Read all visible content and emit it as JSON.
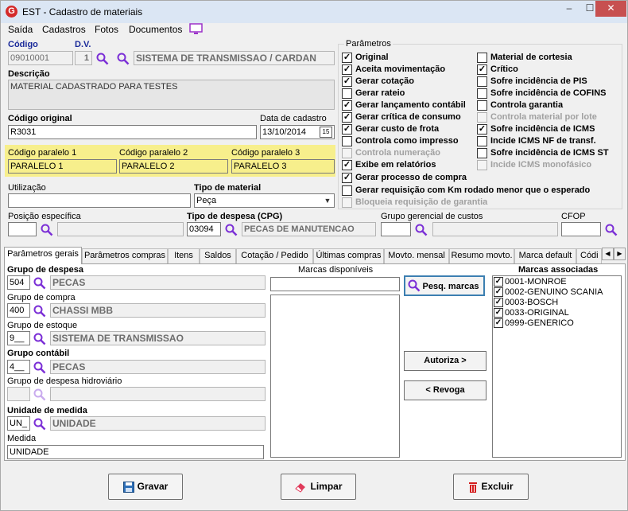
{
  "window": {
    "title": "EST - Cadastro de materiais",
    "minimize": "–",
    "maximize": "☐",
    "close": "✕"
  },
  "menu": [
    {
      "label": "Saída"
    },
    {
      "label": "Cadastros"
    },
    {
      "label": "Fotos"
    },
    {
      "label": "Documentos"
    }
  ],
  "form": {
    "codigo_label": "Código",
    "codigo_value": "09010001",
    "dv_label": "D.V.",
    "dv_value": "1",
    "grupo_value": "SISTEMA DE TRANSMISSAO / CARDAN",
    "descricao_label": "Descrição",
    "descricao_value": "MATERIAL CADASTRADO PARA TESTES",
    "codigo_original_label": "Código original",
    "codigo_original_value": "R3031",
    "data_cadastro_label": "Data de cadastro",
    "data_cadastro_value": "13/10/2014",
    "calendar_label": "15",
    "paralelo1_label": "Código paralelo 1",
    "paralelo1_value": "PARALELO 1",
    "paralelo2_label": "Código paralelo 2",
    "paralelo2_value": "PARALELO 2",
    "paralelo3_label": "Código paralelo 3",
    "paralelo3_value": "PARALELO 3",
    "utilizacao_label": "Utilização",
    "utilizacao_value": "",
    "tipo_material_label": "Tipo de material",
    "tipo_material_value": "Peça",
    "posicao_label": "Posição específica",
    "posicao_value": "",
    "tipo_despesa_label": "Tipo de despesa (CPG)",
    "tipo_despesa_code": "03094",
    "tipo_despesa_desc": "PECAS DE MANUTENCAO",
    "grupo_gerencial_label": "Grupo gerencial de custos",
    "grupo_gerencial_value": "",
    "cfop_label": "CFOP",
    "cfop_value": ""
  },
  "parametros": {
    "title": "Parâmetros",
    "left": [
      {
        "label": "Original",
        "checked": "✓",
        "disabled": false
      },
      {
        "label": "Aceita movimentação",
        "checked": "✓",
        "disabled": false
      },
      {
        "label": "Gerar cotação",
        "checked": "✓",
        "disabled": false
      },
      {
        "label": "Gerar rateio",
        "checked": "",
        "disabled": false
      },
      {
        "label": "Gerar lançamento contábil",
        "checked": "✓",
        "disabled": false
      },
      {
        "label": "Gerar crítica de consumo",
        "checked": "✓",
        "disabled": false
      },
      {
        "label": "Gerar custo de frota",
        "checked": "✓",
        "disabled": false
      },
      {
        "label": "Controla como impresso",
        "checked": "",
        "disabled": false
      },
      {
        "label": "Controla numeração",
        "checked": "",
        "disabled": true
      },
      {
        "label": "Exibe em relatórios",
        "checked": "✓",
        "disabled": false
      }
    ],
    "right": [
      {
        "label": "Material de cortesia",
        "checked": "",
        "disabled": false
      },
      {
        "label": "Crítico",
        "checked": "✓",
        "disabled": false
      },
      {
        "label": "Sofre incidência de PIS",
        "checked": "",
        "disabled": false
      },
      {
        "label": "Sofre incidência de COFINS",
        "checked": "",
        "disabled": false
      },
      {
        "label": "Controla garantia",
        "checked": "",
        "disabled": false
      },
      {
        "label": "Controla material por lote",
        "checked": "",
        "disabled": true
      },
      {
        "label": "Sofre incidência de ICMS",
        "checked": "✓",
        "disabled": false
      },
      {
        "label": "Incide ICMS NF de transf.",
        "checked": "",
        "disabled": false
      },
      {
        "label": "Sofre incidência de ICMS ST",
        "checked": "",
        "disabled": false
      },
      {
        "label": "Incide ICMS monofásico",
        "checked": "",
        "disabled": true
      }
    ],
    "bottom": [
      {
        "label": "Gerar processo de compra",
        "checked": "✓",
        "disabled": false
      },
      {
        "label": "Gerar requisição com Km rodado menor que o esperado",
        "checked": "",
        "disabled": false
      },
      {
        "label": "Bloqueia requisição de garantia",
        "checked": "",
        "disabled": true
      }
    ]
  },
  "tabs": [
    {
      "label": "Parâmetros gerais"
    },
    {
      "label": "Parâmetros compras"
    },
    {
      "label": "Itens"
    },
    {
      "label": "Saldos"
    },
    {
      "label": "Cotação / Pedido"
    },
    {
      "label": "Últimas compras"
    },
    {
      "label": "Movto. mensal"
    },
    {
      "label": "Resumo movto."
    },
    {
      "label": "Marca default"
    },
    {
      "label": "Códi"
    }
  ],
  "tab_scroll": {
    "left": "◀",
    "right": "▶"
  },
  "panel": {
    "grupo_despesa_label": "Grupo de despesa",
    "grupo_despesa_code": "504",
    "grupo_despesa_desc": "PECAS",
    "grupo_compra_label": "Grupo de compra",
    "grupo_compra_code": "400",
    "grupo_compra_desc": "CHASSI MBB",
    "grupo_estoque_label": "Grupo de estoque",
    "grupo_estoque_code": "9__",
    "grupo_estoque_desc": "SISTEMA DE TRANSMISSAO",
    "grupo_contabil_label": "Grupo contábil",
    "grupo_contabil_code": "4__",
    "grupo_contabil_desc": "PECAS",
    "grupo_hidro_label": "Grupo de despesa hidroviário",
    "grupo_hidro_code": "",
    "grupo_hidro_desc": "",
    "unidade_label": "Unidade de medida",
    "unidade_code": "UN_",
    "unidade_desc": "UNIDADE",
    "medida_label": "Medida",
    "medida_value": "UNIDADE",
    "marcas_disponiveis_label": "Marcas disponíveis",
    "marcas_search_value": "",
    "pesq_marcas": "Pesq. marcas",
    "autoriza": "Autoriza >",
    "revoga": "< Revoga",
    "marcas_associadas_label": "Marcas associadas",
    "marcas_associadas": [
      {
        "label": "0001-MONROE",
        "checked": "✓"
      },
      {
        "label": "0002-GENUINO SCANIA",
        "checked": "✓"
      },
      {
        "label": "0003-BOSCH",
        "checked": "✓"
      },
      {
        "label": "0033-ORIGINAL",
        "checked": "✓"
      },
      {
        "label": "0999-GENERICO",
        "checked": "✓"
      }
    ]
  },
  "buttons": {
    "gravar": "Gravar",
    "limpar": "Limpar",
    "excluir": "Excluir"
  }
}
